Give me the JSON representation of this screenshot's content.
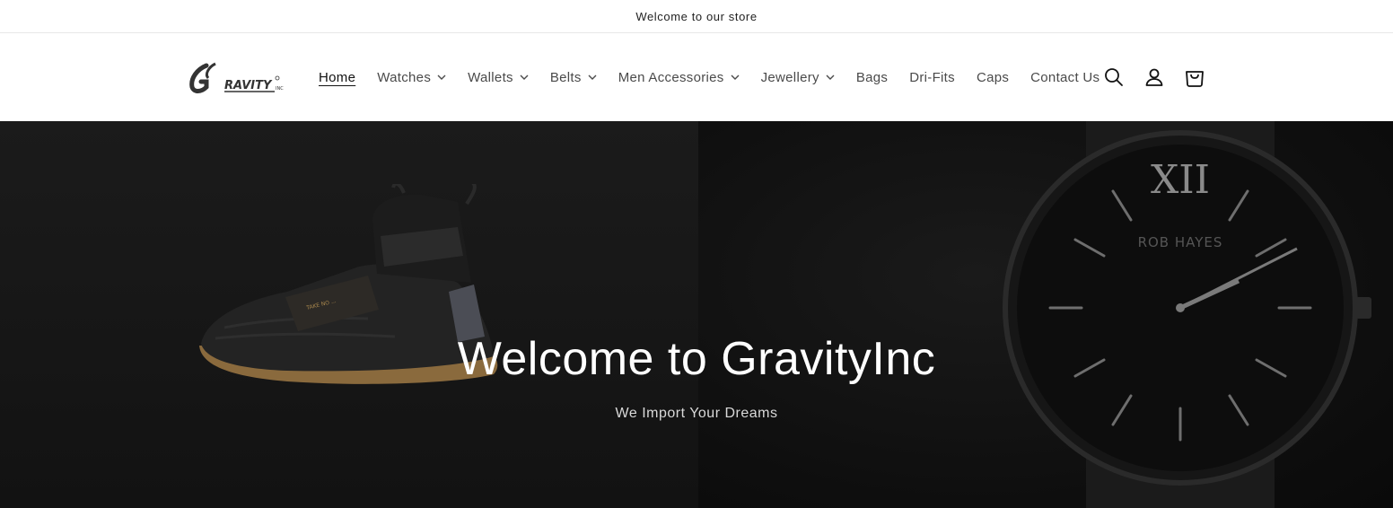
{
  "announcement": {
    "text": "Welcome to our store"
  },
  "logo": {
    "text": "GRAVITY",
    "suffix": "INC"
  },
  "nav": {
    "items": [
      {
        "label": "Home",
        "active": true,
        "dropdown": false
      },
      {
        "label": "Watches",
        "dropdown": true
      },
      {
        "label": "Wallets",
        "dropdown": true
      },
      {
        "label": "Belts",
        "dropdown": true
      },
      {
        "label": "Men Accessories",
        "dropdown": true
      },
      {
        "label": "Jewellery",
        "dropdown": true
      },
      {
        "label": "Bags",
        "dropdown": false
      },
      {
        "label": "Dri-Fits",
        "dropdown": false
      },
      {
        "label": "Caps",
        "dropdown": false
      },
      {
        "label": "Contact Us",
        "dropdown": false
      }
    ]
  },
  "header_icons": [
    "search-icon",
    "account-icon",
    "cart-icon"
  ],
  "hero": {
    "title": "Welcome to GravityInc",
    "subtitle": "We Import Your Dreams",
    "watch_brand": "ROB HAYES",
    "watch_numeral": "XII"
  },
  "colors": {
    "hero_bg": "#101010",
    "text": "#121212",
    "nav_text": "#4a4a4a"
  }
}
